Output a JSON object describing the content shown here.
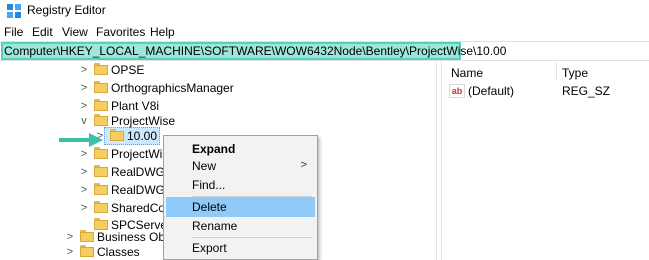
{
  "window": {
    "title": "Registry Editor",
    "icon": "registry-editor-icon"
  },
  "menu": {
    "items": [
      "File",
      "Edit",
      "View",
      "Favorites",
      "Help"
    ]
  },
  "address": {
    "path": "Computer\\HKEY_LOCAL_MACHINE\\SOFTWARE\\WOW6432Node\\Bentley\\ProjectWise\\10.00",
    "highlight_color": "#9ce6dc"
  },
  "tree": {
    "nodes": [
      {
        "label": "OPSE",
        "toggle": ">"
      },
      {
        "label": "OrthographicsManager",
        "toggle": ">"
      },
      {
        "label": "Plant V8i",
        "toggle": ">"
      },
      {
        "label": "ProjectWise",
        "toggle": "v"
      },
      {
        "label": "10.00",
        "toggle": ">"
      },
      {
        "label": "ProjectWis",
        "toggle": ">"
      },
      {
        "label": "RealDWG2",
        "toggle": ">"
      },
      {
        "label": "RealDWG2",
        "toggle": ">"
      },
      {
        "label": "SharedCon",
        "toggle": ">"
      },
      {
        "label": "SPCServer",
        "toggle": ""
      },
      {
        "label": "Business Obje",
        "toggle": ">"
      },
      {
        "label": "Classes",
        "toggle": ">"
      }
    ]
  },
  "list": {
    "columns": [
      "Name",
      "Type"
    ],
    "rows": [
      {
        "name": "(Default)",
        "type": "REG_SZ",
        "icon": "ab-string-icon"
      }
    ]
  },
  "context_menu": {
    "items": [
      {
        "label": "Expand",
        "bold": true
      },
      {
        "label": "New",
        "submenu": true,
        "arrow": ">"
      },
      {
        "label": "Find..."
      },
      {
        "label": "Delete",
        "hover": true
      },
      {
        "label": "Rename"
      },
      {
        "label": "Export"
      }
    ]
  },
  "annotation": {
    "arrow_color": "#3cc0a8"
  }
}
